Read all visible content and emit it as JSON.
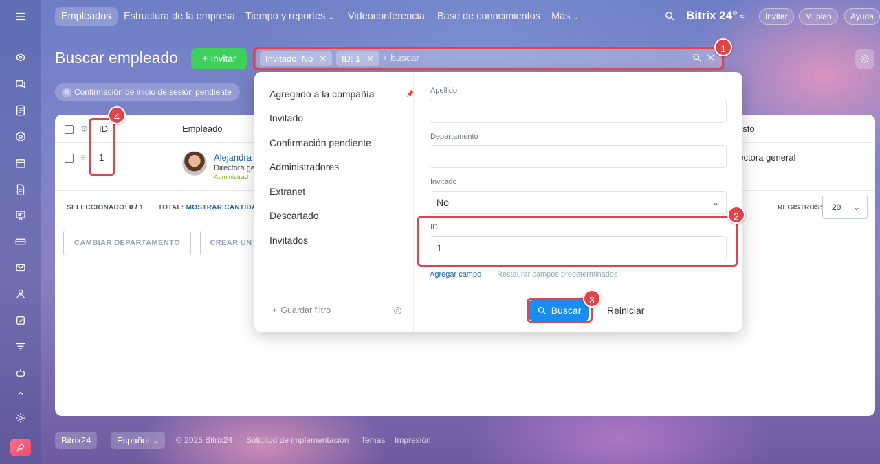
{
  "nav": {
    "items": [
      "Empleados",
      "Estructura de la empresa",
      "Tiempo y reportes",
      "Videoconferencia",
      "Base de conocimientos",
      "Más"
    ],
    "brand": "Bitrix 24",
    "brand_sup": "⊙",
    "invite": "Invitar",
    "plan": "Mi plan",
    "help": "Ayuda"
  },
  "page": {
    "title": "Buscar empleado",
    "invite_button": "Invitar"
  },
  "search": {
    "chips": [
      {
        "label": "Invitado: No"
      },
      {
        "label": "ID: 1"
      }
    ],
    "placeholder": "+ buscar"
  },
  "pending": {
    "count": "0",
    "label": "Confirmación de inicio de sesión pendiente"
  },
  "table": {
    "headers": [
      "ID",
      "Empleado",
      "esto"
    ],
    "row": {
      "id": "1",
      "name": "Alejandra",
      "position": "Directora ge",
      "role": "Administrad",
      "puesto": "rectora general"
    },
    "selected_label": "SELECCIONADO:",
    "selected_value": "0 / 1",
    "total_label": "TOTAL:",
    "total_link": "MOSTRAR CANTIDA",
    "records_label": "REGISTROS:",
    "records_value": "20",
    "actions": [
      "CAMBIAR DEPARTAMENTO",
      "CREAR UN"
    ]
  },
  "filter_popup": {
    "presets": [
      "Agregado a la compañía",
      "Invitado",
      "Confirmación pendiente",
      "Administradores",
      "Extranet",
      "Descartado",
      "Invitados"
    ],
    "save_filter": "Guardar filtro",
    "fields": [
      {
        "label": "Apellido",
        "value": ""
      },
      {
        "label": "Departamento",
        "value": ""
      },
      {
        "label": "Invitado",
        "value": "No"
      },
      {
        "label": "ID",
        "value": "1"
      }
    ],
    "add_field": "Agregar campo",
    "restore_fields": "Restaurar campos predeterminados",
    "search_button": "Buscar",
    "reset_button": "Reiniciar"
  },
  "footer": {
    "brand": "Bitrix24",
    "language": "Español",
    "copyright": "© 2025 Bitrix24",
    "links": [
      "Solicitud de implementación",
      "Temas",
      "Impresión"
    ]
  },
  "callouts": [
    "1",
    "2",
    "3",
    "4"
  ],
  "colors": {
    "accent_blue": "#1b8cf0",
    "invite_green": "#3ecf5c",
    "callout_red": "#e1434b",
    "link_blue": "#2066b0"
  }
}
